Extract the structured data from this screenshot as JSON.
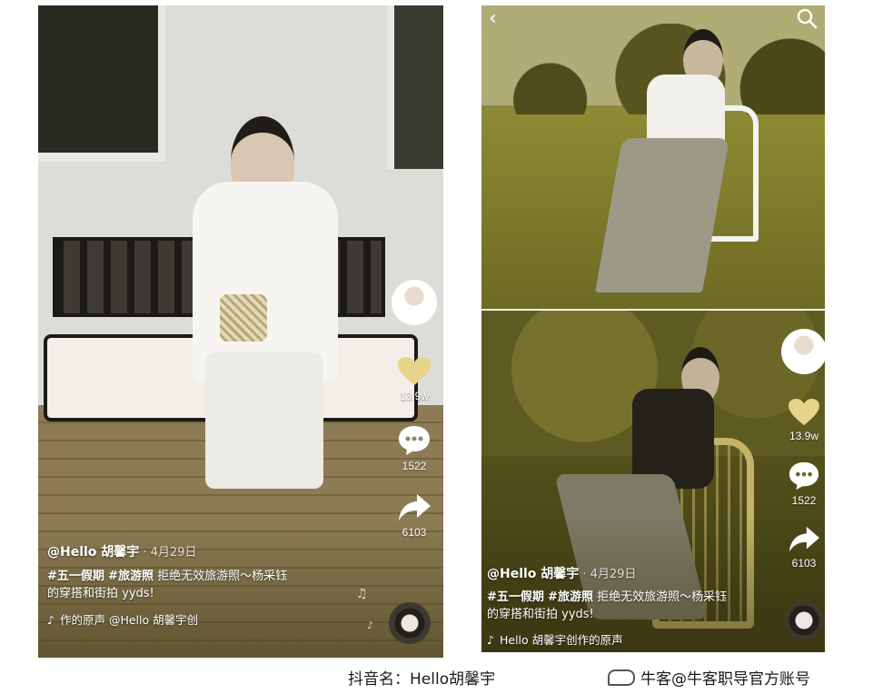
{
  "colors": {
    "like": "#e7d38a",
    "text_white": "#ffffff",
    "footer_text": "#1a1a1a"
  },
  "icons": {
    "like": "heart-icon",
    "comment": "comment-bubble-icon",
    "share": "share-arrow-icon",
    "back": "chevron-left-icon",
    "search": "search-icon",
    "music": "music-note-icon"
  },
  "left_post": {
    "username": "@Hello 胡馨宇",
    "date": "· 4月29日",
    "tag1": "#五一假期",
    "tag2": "#旅游照",
    "desc_text": "拒绝无效旅游照～杨采钰",
    "desc_line2": "的穿搭和街拍 yyds!",
    "music_icon": "♪",
    "music_text": "作的原声    @Hello 胡馨宇创",
    "likes": "13.9w",
    "comments": "1522",
    "shares": "6103"
  },
  "right_post": {
    "username": "@Hello 胡馨宇",
    "date": "· 4月29日",
    "tag1": "#五一假期",
    "tag2": "#旅游照",
    "desc_text": "拒绝无效旅游照～杨采钰",
    "desc_line2": "的穿搭和街拍 yyds!",
    "music_icon": "♪",
    "music_text": "Hello 胡馨宇创作的原声",
    "likes": "13.9w",
    "comments": "1522",
    "shares": "6103"
  },
  "footer": {
    "account_label": "抖音名：Hello胡馨宇",
    "watermark": "牛客@牛客职导官方账号"
  }
}
